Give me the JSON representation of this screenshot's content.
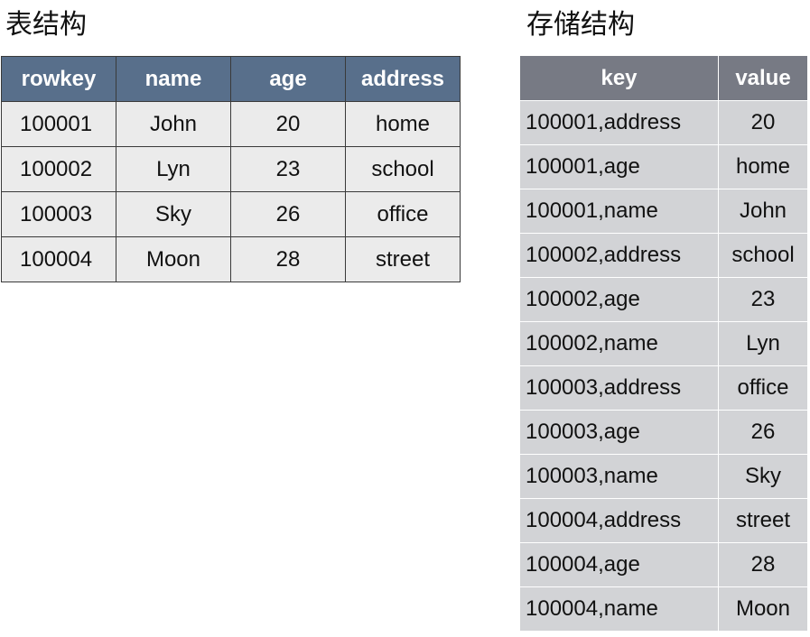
{
  "table_title": "表结构",
  "storage_title": "存储结构",
  "table": {
    "headers": [
      "rowkey",
      "name",
      "age",
      "address"
    ],
    "rows": [
      [
        "100001",
        "John",
        "20",
        "home"
      ],
      [
        "100002",
        "Lyn",
        "23",
        "school"
      ],
      [
        "100003",
        "Sky",
        "26",
        "office"
      ],
      [
        "100004",
        "Moon",
        "28",
        "street"
      ]
    ]
  },
  "storage": {
    "headers": [
      "key",
      "value"
    ],
    "rows": [
      [
        "100001,address",
        "20"
      ],
      [
        "100001,age",
        "home"
      ],
      [
        "100001,name",
        "John"
      ],
      [
        "100002,address",
        "school"
      ],
      [
        "100002,age",
        "23"
      ],
      [
        "100002,name",
        "Lyn"
      ],
      [
        "100003,address",
        "office"
      ],
      [
        "100003,age",
        "26"
      ],
      [
        "100003,name",
        "Sky"
      ],
      [
        "100004,address",
        "street"
      ],
      [
        "100004,age",
        "28"
      ],
      [
        "100004,name",
        "Moon"
      ]
    ]
  },
  "colors": {
    "table_header": "#586f8b",
    "table_cell": "#ebebeb",
    "storage_header": "#777a84",
    "storage_cell": "#d2d3d6"
  }
}
